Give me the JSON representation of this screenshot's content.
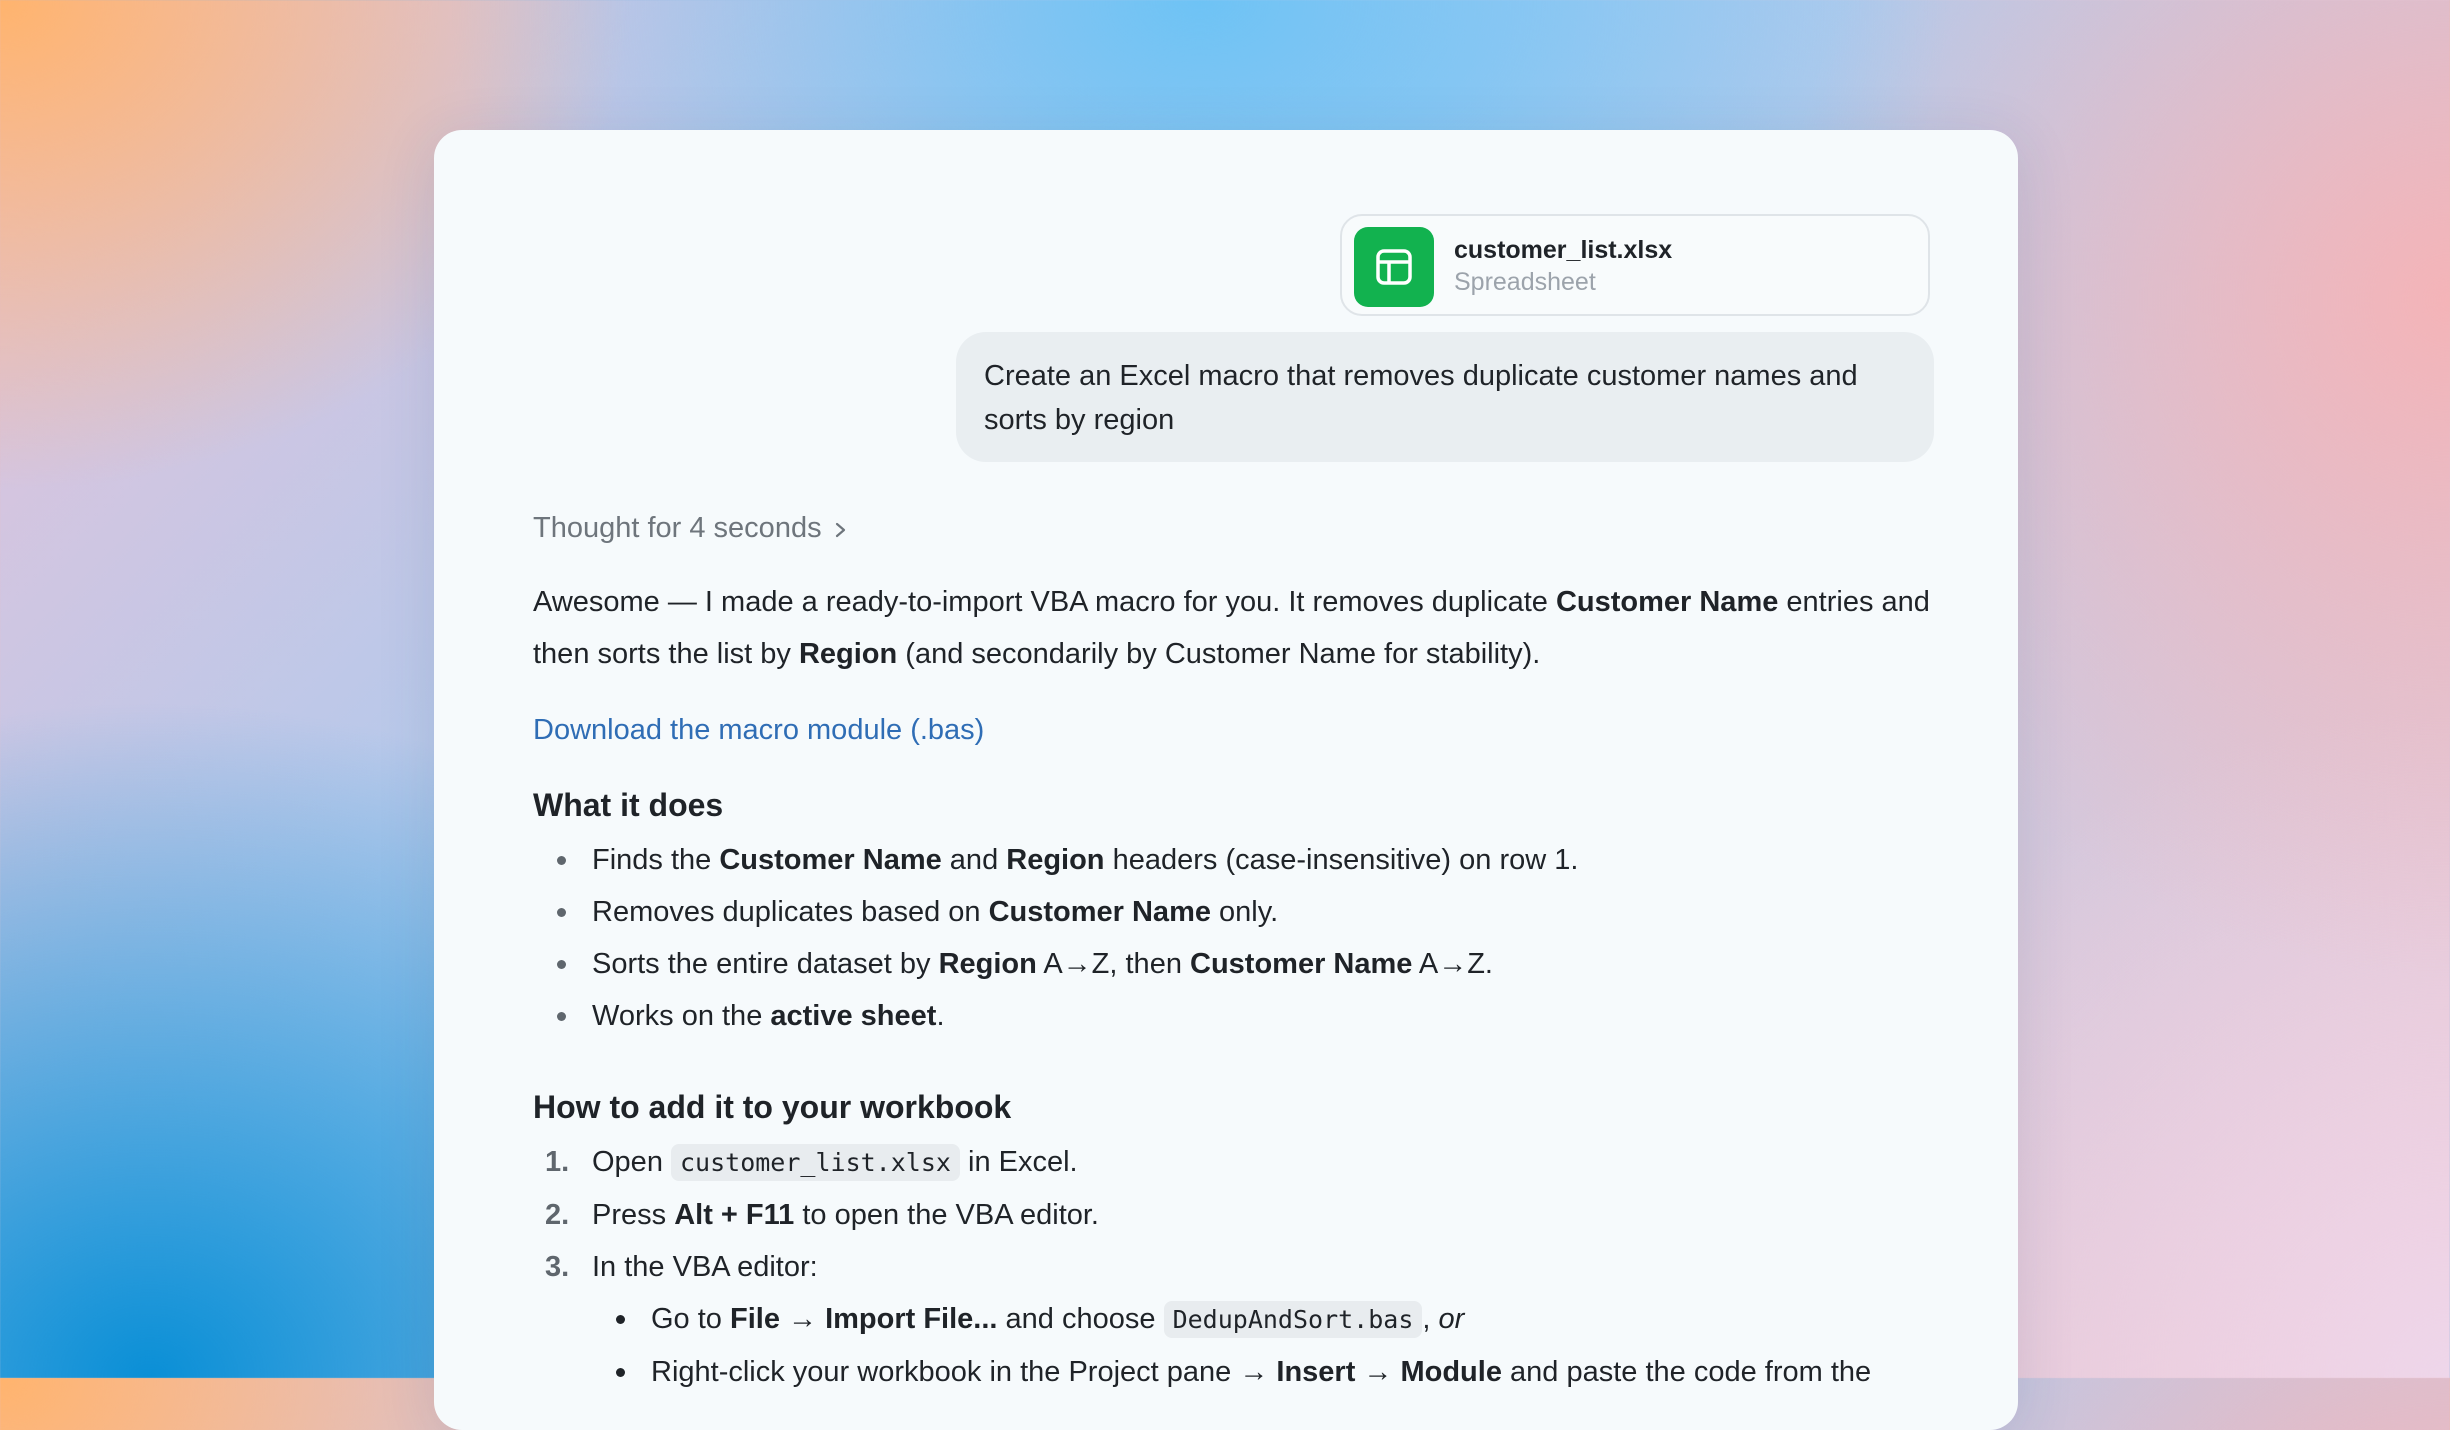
{
  "attachment": {
    "name": "customer_list.xlsx",
    "type": "Spreadsheet",
    "icon": "spreadsheet-icon",
    "icon_color": "#12b24f"
  },
  "user_message": "Create an Excel macro that removes duplicate customer names and sorts by region",
  "thought": {
    "label": "Thought for 4 seconds",
    "icon": "chevron-right-icon"
  },
  "intro": {
    "p1": "Awesome — I made a ready-to-import VBA macro for you. It removes duplicate ",
    "b1": "Customer Name",
    "p2": " entries and then sorts the list by ",
    "b2": "Region",
    "p3": " (and secondarily by Customer Name for stability)."
  },
  "download_link": "Download the macro module (.bas)",
  "what_it_does": {
    "heading": "What it does",
    "items": [
      {
        "a": "Finds the ",
        "b1": "Customer Name",
        "c": " and ",
        "b2": "Region",
        "d": " headers (case-insensitive) on row 1."
      },
      {
        "a": "Removes duplicates based on ",
        "b1": "Customer Name",
        "c": " only."
      },
      {
        "a": "Sorts the entire dataset by ",
        "b1": "Region",
        "c": " A→Z, then ",
        "b2": "Customer Name",
        "d": " A→Z."
      },
      {
        "a": "Works on the ",
        "b1": "active sheet",
        "c": "."
      }
    ]
  },
  "how_to_add": {
    "heading": "How to add it to your workbook",
    "steps": [
      {
        "num": "1.",
        "a": "Open ",
        "code": "customer_list.xlsx",
        "b": " in Excel."
      },
      {
        "num": "2.",
        "a": "Press ",
        "bold": "Alt + F11",
        "b": " to open the VBA editor."
      },
      {
        "num": "3.",
        "a": "In the VBA editor:"
      }
    ],
    "sub_items": [
      {
        "a": "Go to ",
        "b1": "File → Import File...",
        "c": " and choose ",
        "code": "DedupAndSort.bas",
        "d": ", ",
        "em": "or"
      },
      {
        "a": "Right-click your workbook in the Project pane → ",
        "b1": "Insert → Module",
        "c": " and paste the code from the"
      }
    ]
  }
}
